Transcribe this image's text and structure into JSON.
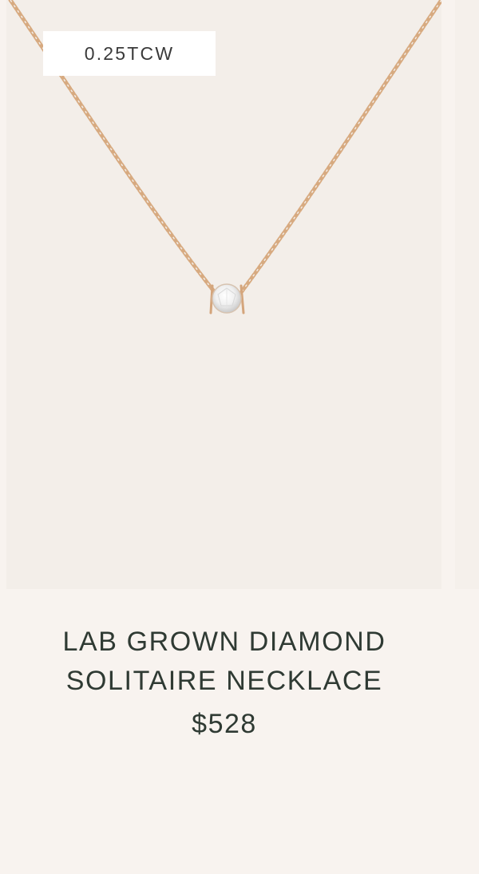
{
  "product": {
    "badge": "0.25TCW",
    "title": "LAB GROWN DIAMOND SOLITAIRE NECKLACE",
    "price": "$528",
    "image_icon": "solitaire-necklace-image",
    "colors": {
      "chain": "#d4a57c",
      "image_background": "#f3eee9",
      "page_background": "#f8f3ef",
      "text": "#2f3a33"
    }
  }
}
